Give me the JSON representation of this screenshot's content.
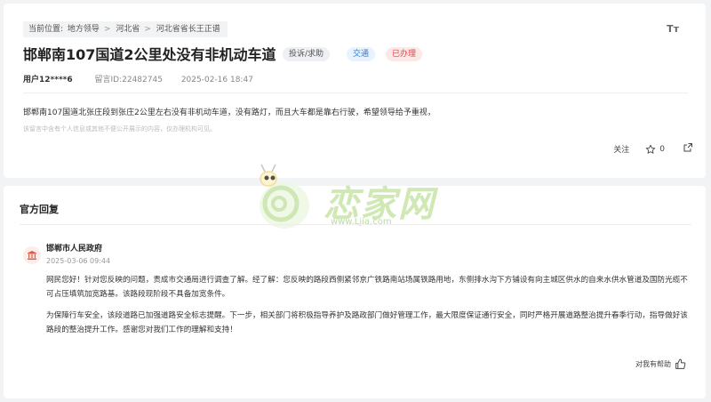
{
  "breadcrumb": {
    "label": "当前位置:",
    "items": [
      "地方领导",
      "河北省",
      "河北省省长王正谱"
    ]
  },
  "font_toggle": "Tт",
  "post": {
    "title": "邯郸南107国道2公里处没有非机动车道",
    "tags": {
      "type": "投诉/求助",
      "category": "交通",
      "status": "已办理"
    },
    "user": "用户12****6",
    "message_id": "留言ID:22482745",
    "timestamp": "2025-02-16 18:47",
    "content": "邯郸南107国道北张庄段到张庄2公里左右没有非机动车道，没有路灯，而且大车都是靠右行驶，希望领导给予重视，",
    "notice": "该留言中含有个人信息或其他不便公开展示的内容，仅办理机构可见。"
  },
  "actions": {
    "follow_label": "关注",
    "like_count": "0"
  },
  "official": {
    "section_title": "官方回复",
    "org_name": "邯郸市人民政府",
    "reply_time": "2025-03-06 09:44",
    "reply_paragraph_1": "网民您好！针对您反映的问题，责成市交通局进行调查了解。经了解：您反映的路段西侧紧邻京广铁路南站场属铁路用地，东侧排水沟下方铺设有向主城区供水的自来水供水管道及国防光缆不可占压填筑加宽路基。该路段现阶段不具备加宽条件。",
    "reply_paragraph_2": "为保障行车安全，该段道路已加强道路安全标志提醒。下一步，相关部门将积极指导养护及路政部门做好管理工作，最大限度保证通行安全，同时严格开展道路整治提升春季行动，指导做好该路段的整治提升工作。感谢您对我们工作的理解和支持！",
    "helpful_label": "对我有帮助"
  },
  "watermark": {
    "text": "恋家网",
    "url": "www.Ljia.com"
  },
  "colors": {
    "tag_category": "#2a7fd4",
    "tag_status": "#e04545",
    "watermark": "#cfe8b4"
  },
  "icons": [
    "font-size-icon",
    "star-icon",
    "share-icon",
    "government-icon",
    "thumbs-up-icon"
  ]
}
